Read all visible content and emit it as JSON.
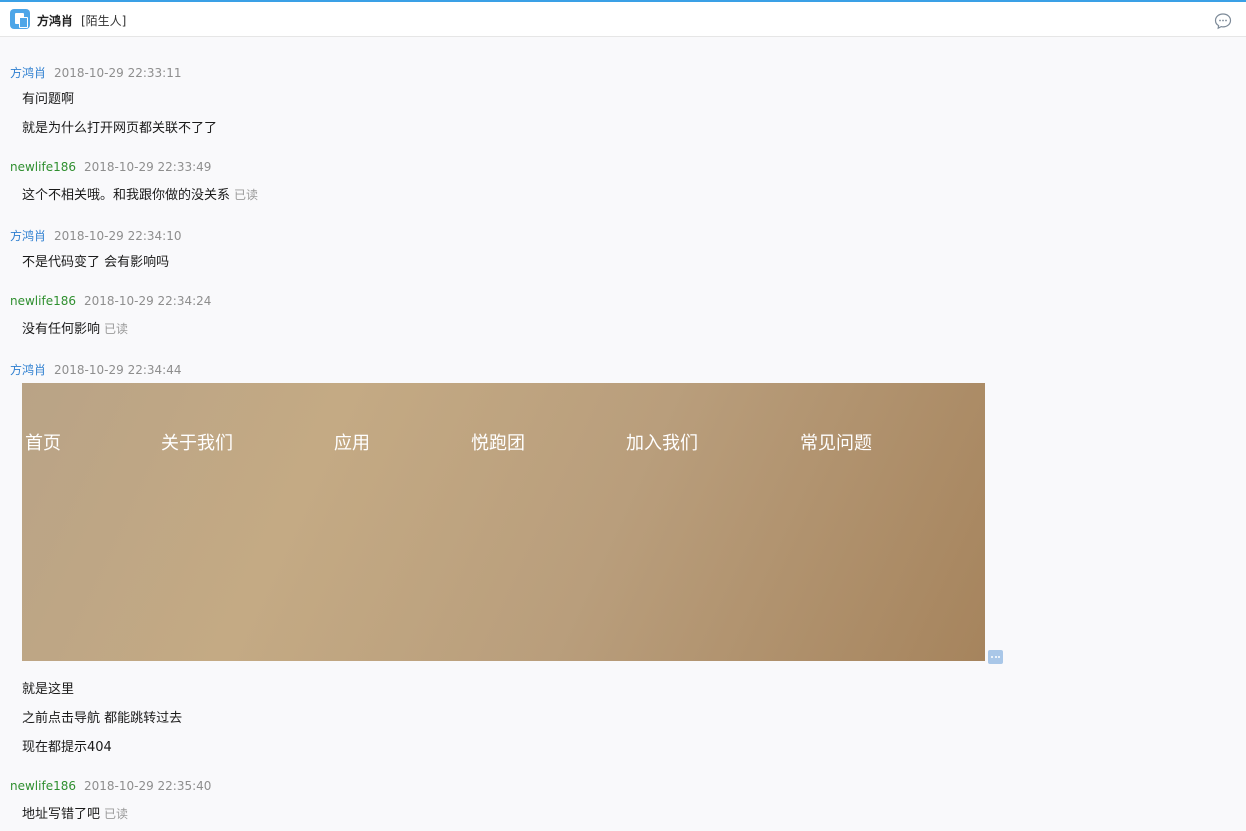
{
  "header": {
    "contact_name": "方鸿肖",
    "contact_tag": "[陌生人]"
  },
  "labels": {
    "read": "已读"
  },
  "messages": [
    {
      "sender": "方鸿肖",
      "time": "2018-10-29 22:33:11",
      "lines": [
        "有问题啊",
        "就是为什么打开网页都关联不了了"
      ]
    },
    {
      "sender": "newlife186",
      "time": "2018-10-29 22:33:49",
      "lines": [
        "这个不相关哦。和我跟你做的没关系"
      ]
    },
    {
      "sender": "方鸿肖",
      "time": "2018-10-29 22:34:10",
      "lines": [
        "不是代码变了 会有影响吗"
      ]
    },
    {
      "sender": "newlife186",
      "time": "2018-10-29 22:34:24",
      "lines": [
        "没有任何影响"
      ]
    },
    {
      "sender": "方鸿肖",
      "time": "2018-10-29 22:34:44",
      "image_nav": [
        "首页",
        "关于我们",
        "应用",
        "悦跑团",
        "加入我们",
        "常见问题"
      ],
      "lines": [
        "就是这里",
        "之前点击导航 都能跳转过去",
        "现在都提示404"
      ]
    },
    {
      "sender": "newlife186",
      "time": "2018-10-29 22:35:40",
      "lines": [
        "地址写错了吧"
      ]
    }
  ]
}
